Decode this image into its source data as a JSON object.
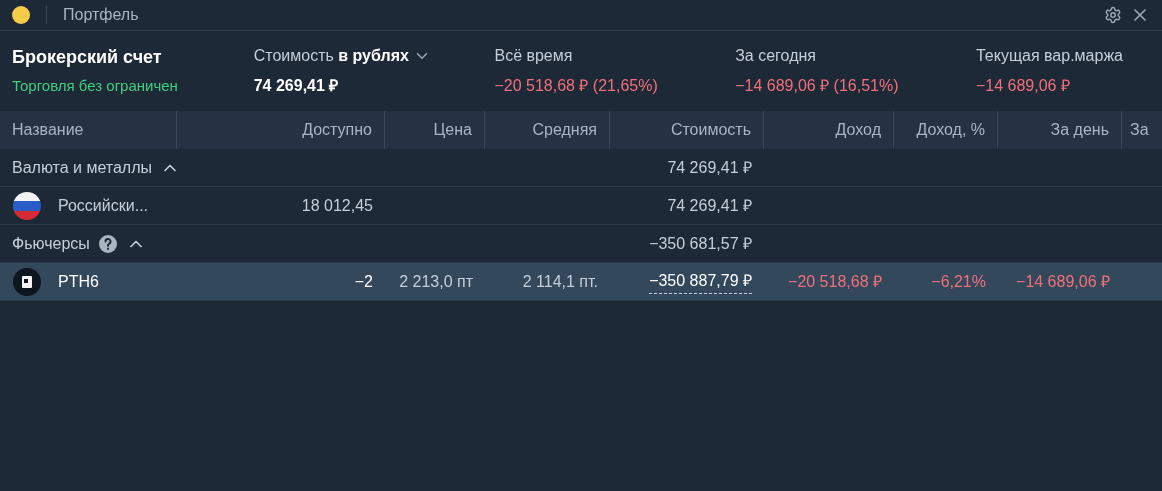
{
  "window": {
    "title": "Портфель"
  },
  "account": {
    "title": "Брокерский счет",
    "status": "Торговля без ограничен"
  },
  "summary": [
    {
      "label": "Стоимость **в рублях**",
      "dropdown": true,
      "value": "74 269,41 ₽",
      "negative": false
    },
    {
      "label": "Всё время",
      "dropdown": false,
      "value": "−20 518,68 ₽ (21,65%)",
      "negative": true
    },
    {
      "label": "За сегодня",
      "dropdown": false,
      "value": "−14 689,06 ₽ (16,51%)",
      "negative": true
    },
    {
      "label": "Текущая вар.маржа",
      "dropdown": false,
      "value": "−14 689,06 ₽",
      "negative": true
    }
  ],
  "table": {
    "columns": [
      "Название",
      "Доступно",
      "Цена",
      "Средняя",
      "Стоимость",
      "Доход",
      "Доход, %",
      "За день",
      "За"
    ],
    "rows": [
      {
        "kind": "group",
        "help": false,
        "expanded": true,
        "selected": false,
        "cells": [
          {
            "text": "Валюта и металлы"
          },
          "",
          "",
          "",
          {
            "text": "74 269,41 ₽"
          },
          "",
          "",
          "",
          ""
        ]
      },
      {
        "kind": "currency",
        "selected": false,
        "cells": [
          {
            "text": "Российски..."
          },
          {
            "text": "18 012,45"
          },
          "",
          "",
          {
            "text": "74 269,41 ₽"
          },
          "",
          "",
          "",
          ""
        ]
      },
      {
        "kind": "group",
        "help": true,
        "expanded": true,
        "selected": false,
        "cells": [
          {
            "text": "Фьючерсы"
          },
          "",
          "",
          "",
          {
            "text": "−350 681,57 ₽"
          },
          "",
          "",
          "",
          ""
        ]
      },
      {
        "kind": "future",
        "selected": true,
        "cells": [
          {
            "text": "PTH6"
          },
          {
            "text": "−2",
            "bright": true
          },
          {
            "text": "2 213,0 пт"
          },
          {
            "text": "2 114,1 пт."
          },
          {
            "text": "−350 887,79 ₽",
            "bright": true,
            "dotted": true
          },
          {
            "text": "−20 518,68 ₽",
            "negative": true
          },
          {
            "text": "−6,21%",
            "negative": true
          },
          {
            "text": "−14 689,06 ₽",
            "negative": true
          },
          ""
        ]
      }
    ]
  }
}
